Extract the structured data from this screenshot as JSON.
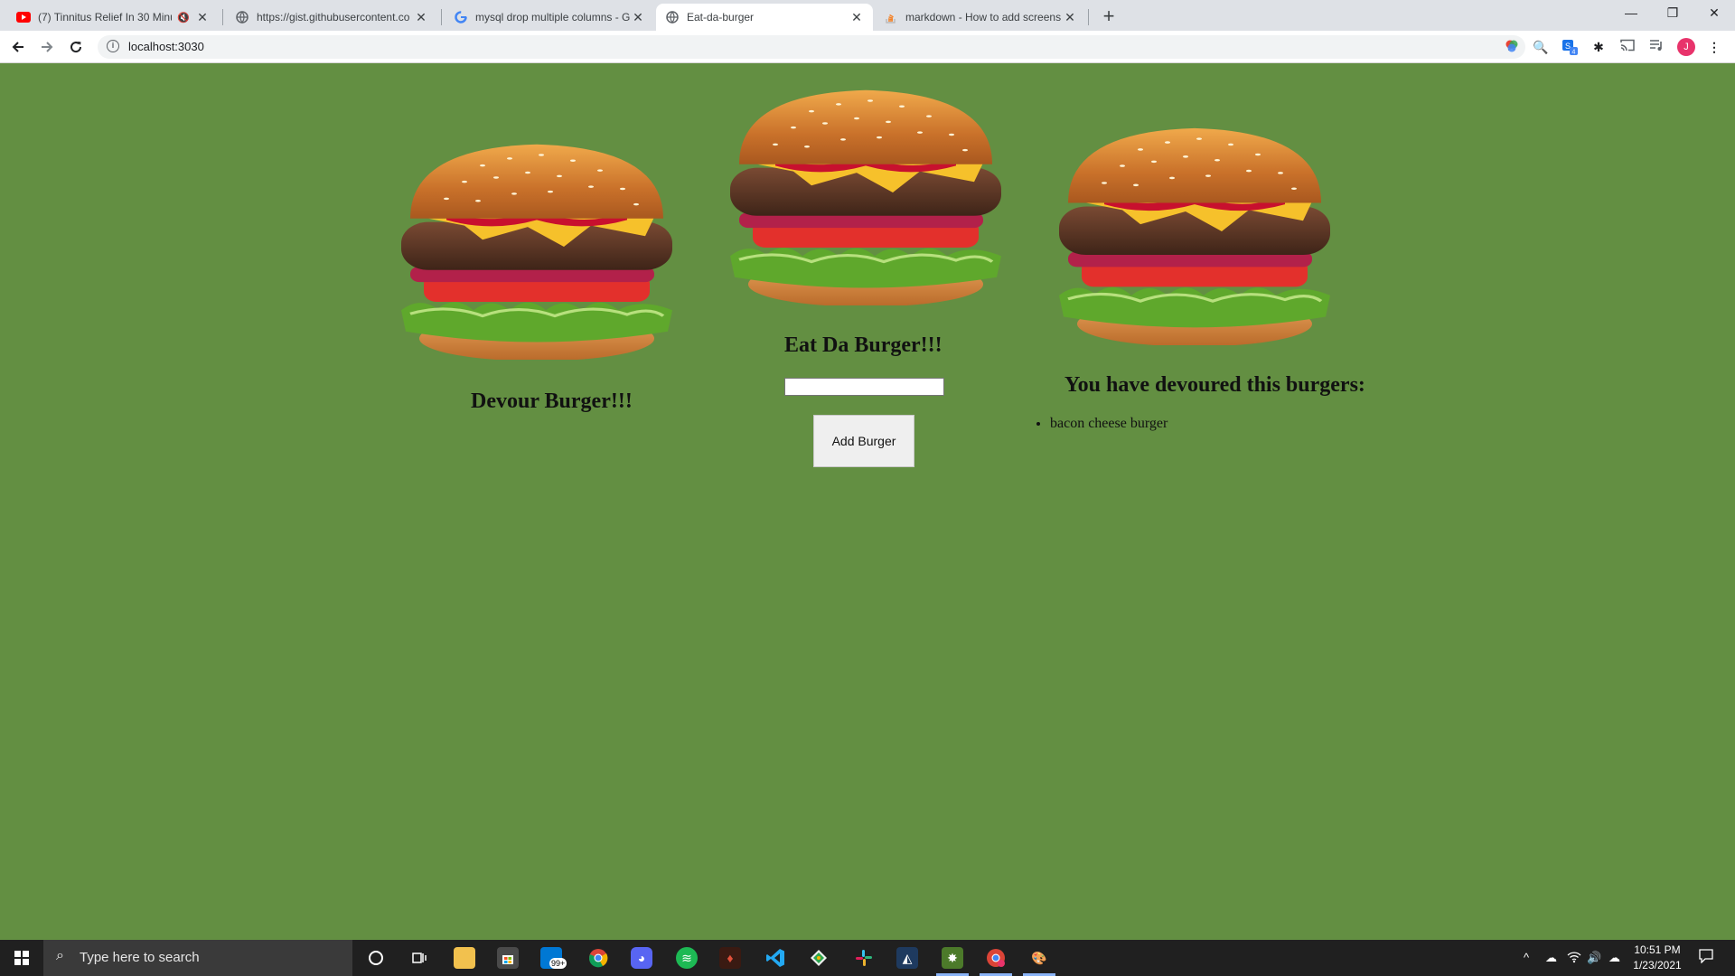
{
  "browser": {
    "tabs": [
      {
        "title": "(7) Tinnitus Relief In 30 Minu",
        "icon": "youtube-icon",
        "muted": true
      },
      {
        "title": "https://gist.githubusercontent.co",
        "icon": "globe-icon"
      },
      {
        "title": "mysql drop multiple columns - G",
        "icon": "google-icon"
      },
      {
        "title": "Eat-da-burger",
        "icon": "globe-icon",
        "active": true
      },
      {
        "title": "markdown - How to add screens",
        "icon": "stackoverflow-icon"
      }
    ],
    "address": "localhost:3030",
    "profile_initial": "J",
    "extension_badge": "4"
  },
  "page": {
    "center_heading": "Eat Da Burger!!!",
    "left_heading": "Devour Burger!!!",
    "right_heading": "You have devoured this burgers:",
    "add_button": "Add Burger",
    "input_value": "",
    "devoured": [
      "bacon cheese burger"
    ],
    "colors": {
      "background": "#638f42"
    }
  },
  "taskbar": {
    "search_placeholder": "Type here to search",
    "mail_badge": "99+",
    "time": "10:51 PM",
    "date": "1/23/2021"
  }
}
